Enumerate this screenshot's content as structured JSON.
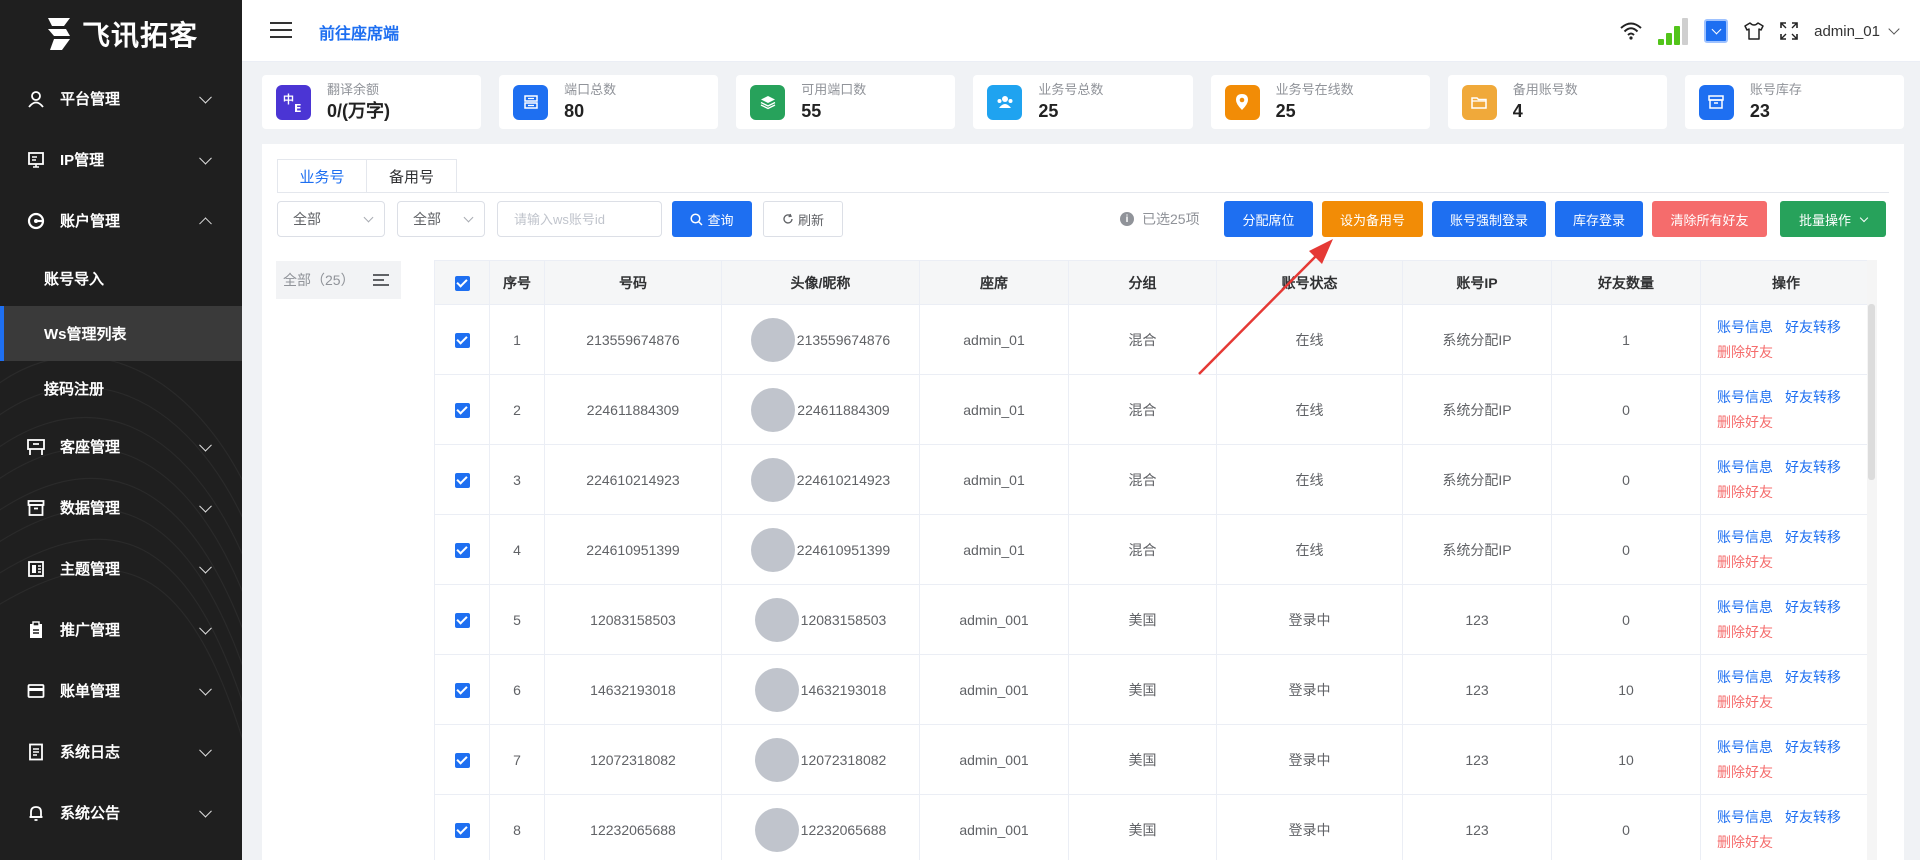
{
  "brand": {
    "logo_text": "飞讯拓客",
    "logo_icon": "stacked-s-logo"
  },
  "sidebar": {
    "items": [
      {
        "label": "平台管理",
        "icon": "user-icon",
        "expanded": false
      },
      {
        "label": "IP管理",
        "icon": "monitor-icon",
        "expanded": false
      },
      {
        "label": "账户管理",
        "icon": "account-icon",
        "expanded": true,
        "children": [
          {
            "label": "账号导入",
            "active": false
          },
          {
            "label": "Ws管理列表",
            "active": true
          },
          {
            "label": "接码注册",
            "active": false
          }
        ]
      },
      {
        "label": "客座管理",
        "icon": "desk-icon",
        "expanded": false
      },
      {
        "label": "数据管理",
        "icon": "archive-icon",
        "expanded": false
      },
      {
        "label": "主题管理",
        "icon": "theme-icon",
        "expanded": false
      },
      {
        "label": "推广管理",
        "icon": "clipboard-icon",
        "expanded": false
      },
      {
        "label": "账单管理",
        "icon": "card-icon",
        "expanded": false
      },
      {
        "label": "系统日志",
        "icon": "log-icon",
        "expanded": false
      },
      {
        "label": "系统公告",
        "icon": "bell-icon",
        "expanded": false
      }
    ]
  },
  "header": {
    "link": "前往座席端",
    "username": "admin_01",
    "icons": [
      "wifi-icon",
      "signal-icon",
      "checkbox-dropdown-icon",
      "shirt-icon",
      "fullscreen-icon"
    ]
  },
  "stats": [
    {
      "label": "翻译余额",
      "value": "0/(万字)",
      "icon": "translate-icon",
      "color": "#4b35d4"
    },
    {
      "label": "端口总数",
      "value": "80",
      "icon": "server-icon",
      "color": "#1e6ff1"
    },
    {
      "label": "可用端口数",
      "value": "55",
      "icon": "layers-icon",
      "color": "#27a25b"
    },
    {
      "label": "业务号总数",
      "value": "25",
      "icon": "team-icon",
      "color": "#1fa3f0"
    },
    {
      "label": "业务号在线数",
      "value": "25",
      "icon": "location-icon",
      "color": "#f28c06"
    },
    {
      "label": "备用账号数",
      "value": "4",
      "icon": "folder-icon",
      "color": "#f0a93a"
    },
    {
      "label": "账号库存",
      "value": "23",
      "icon": "archive-icon",
      "color": "#1e6ff1"
    }
  ],
  "tabs": [
    {
      "label": "业务号",
      "active": true
    },
    {
      "label": "备用号",
      "active": false
    }
  ],
  "filters": {
    "select1": "全部",
    "select2": "全部",
    "search_placeholder": "请输入ws账号id",
    "query_label": "查询",
    "refresh_label": "刷新"
  },
  "selected_info": "已选25项",
  "actions": {
    "assign_seat": "分配席位",
    "set_backup": "设为备用号",
    "force_login": "账号强制登录",
    "stock_login": "库存登录",
    "clear_friends": "清除所有好友",
    "batch": "批量操作"
  },
  "group_filter": {
    "label": "全部",
    "count": "（25）"
  },
  "table": {
    "columns": [
      "序号",
      "号码",
      "头像/昵称",
      "座席",
      "分组",
      "账号状态",
      "账号IP",
      "好友数量",
      "操作"
    ],
    "ops": {
      "info": "账号信息",
      "transfer": "好友转移",
      "delete": "删除好友"
    },
    "rows": [
      {
        "index": "1",
        "number": "213559674876",
        "nickname": "213559674876",
        "seat": "admin_01",
        "group": "混合",
        "status": "在线",
        "status_type": "online",
        "ip": "系统分配IP",
        "friends": "1"
      },
      {
        "index": "2",
        "number": "224611884309",
        "nickname": "224611884309",
        "seat": "admin_01",
        "group": "混合",
        "status": "在线",
        "status_type": "online",
        "ip": "系统分配IP",
        "friends": "0"
      },
      {
        "index": "3",
        "number": "224610214923",
        "nickname": "224610214923",
        "seat": "admin_01",
        "group": "混合",
        "status": "在线",
        "status_type": "online",
        "ip": "系统分配IP",
        "friends": "0"
      },
      {
        "index": "4",
        "number": "224610951399",
        "nickname": "224610951399",
        "seat": "admin_01",
        "group": "混合",
        "status": "在线",
        "status_type": "online",
        "ip": "系统分配IP",
        "friends": "0"
      },
      {
        "index": "5",
        "number": "12083158503",
        "nickname": "12083158503",
        "seat": "admin_001",
        "group": "美国",
        "status": "登录中",
        "status_type": "login",
        "ip": "123",
        "friends": "0"
      },
      {
        "index": "6",
        "number": "14632193018",
        "nickname": "14632193018",
        "seat": "admin_001",
        "group": "美国",
        "status": "登录中",
        "status_type": "login",
        "ip": "123",
        "friends": "10"
      },
      {
        "index": "7",
        "number": "12072318082",
        "nickname": "12072318082",
        "seat": "admin_001",
        "group": "美国",
        "status": "登录中",
        "status_type": "login",
        "ip": "123",
        "friends": "10"
      },
      {
        "index": "8",
        "number": "12232065688",
        "nickname": "12232065688",
        "seat": "admin_001",
        "group": "美国",
        "status": "登录中",
        "status_type": "login",
        "ip": "123",
        "friends": "0"
      }
    ]
  },
  "annotation": {
    "color": "#e53935",
    "points_to": "set_backup"
  },
  "colors": {
    "primary": "#1e6ff1",
    "online": "#67c23a",
    "danger": "#f56c6c",
    "sidebar_bg": "#1f1f1f"
  }
}
